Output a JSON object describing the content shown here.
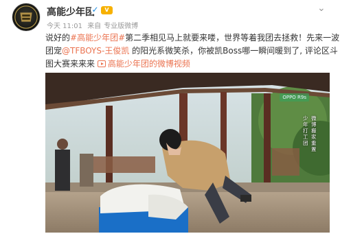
{
  "post": {
    "author": "高能少年团",
    "verified_icon": "✓",
    "vip_badge": "V",
    "time": "今天 11:01",
    "source_prefix": "来自",
    "source": "专业版微博",
    "text": {
      "l1_a": "说好的",
      "l1_topic": "#高能少年团#",
      "l1_b": "第二季相见马上就要来喽，世界等着我团去拯救！先来一波",
      "l2_a": "团宠",
      "l2_mention": "@TFBOYS-王俊凯",
      "l2_b": " 的阳光系微笑杀，你被凯Boss哪一瞬间暖到了, 评论区斗",
      "l3_a": "图大赛来来来",
      "video_link": "高能少年团的微博视频"
    },
    "video": {
      "watermark": "OPPO R9s",
      "caption_1": "少年打工团",
      "caption_2": "微博搬家重置"
    }
  },
  "icons": {
    "avatar": "avatar-logo",
    "chevron": "chevron-down-icon",
    "play": "video-play-icon"
  },
  "colors": {
    "link": "#eb7350",
    "verified": "#1b8be0",
    "vip": "#f7b100"
  }
}
